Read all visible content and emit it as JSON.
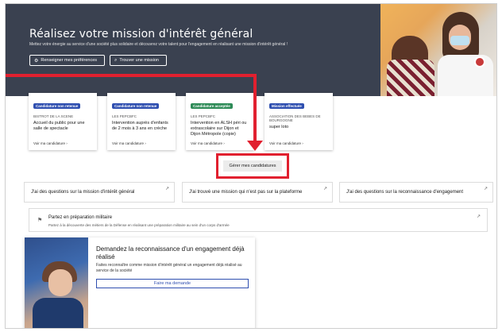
{
  "hero": {
    "title": "Réalisez votre mission d'intérêt général",
    "subtitle": "Mettez votre énergie au service d'une société plus solidaire et découvrez votre talent pour l'engagement en réalisant une mission d'intérêt général !",
    "btn_preferences": "Renseigner mes préférences",
    "btn_find": "Trouver une mission"
  },
  "cards": [
    {
      "tag": "Candidature non retenue",
      "tag_color": "#2f4fb0",
      "org": "BISTROT DE LA SCENE",
      "title": "Accueil du public pour une salle de spectacle",
      "link": "Voir ma candidature ›"
    },
    {
      "tag": "Candidature non retenue",
      "tag_color": "#2f4fb0",
      "org": "LES PEPCBFC",
      "title": "Intervention auprès d'enfants de 2 mois à 3 ans en crèche",
      "link": "Voir ma candidature ›"
    },
    {
      "tag": "Candidature acceptée",
      "tag_color": "#2e8b57",
      "org": "LES PEPCBFC",
      "title": "Intervention en ALSH péri ou extrascolaire sur Dijon et Dijon Métropole (copie)",
      "link": "Voir ma candidature ›"
    },
    {
      "tag": "Mission effectuée",
      "tag_color": "#2f4fb0",
      "org": "ASSOCIATION DES BEBES DE BOURGOGNE",
      "title": "super loto",
      "link": "Voir ma candidature ›"
    }
  ],
  "manage_button": "Gérer mes candidatures",
  "questions": [
    "J'ai des questions sur la mission d'intérêt général",
    "J'ai trouvé une mission qui n'est pas sur la plateforme",
    "J'ai des questions sur la reconnaissance d'engagement"
  ],
  "prep": {
    "title": "Partez en préparation militaire",
    "desc": "Partez à la découverte des métiers de la Défense en réalisant une préparation militaire au sein d'un corps d'armée"
  },
  "request": {
    "title": "Demandez la reconnaissance d'un engagement déjà réalisé",
    "desc": "Faites reconnaître comme mission d'intérêt général un engagement déjà réalisé au service de la société",
    "button": "Faire ma demande"
  },
  "icons": {
    "preferences": "sliders-icon",
    "search": "search-icon",
    "external": "arrow-up-right-icon",
    "military": "medal-icon"
  },
  "colors": {
    "hero_bg": "#3a4150",
    "annotation": "#e1202f",
    "primary": "#2f4fb0",
    "success": "#2e8b57"
  }
}
